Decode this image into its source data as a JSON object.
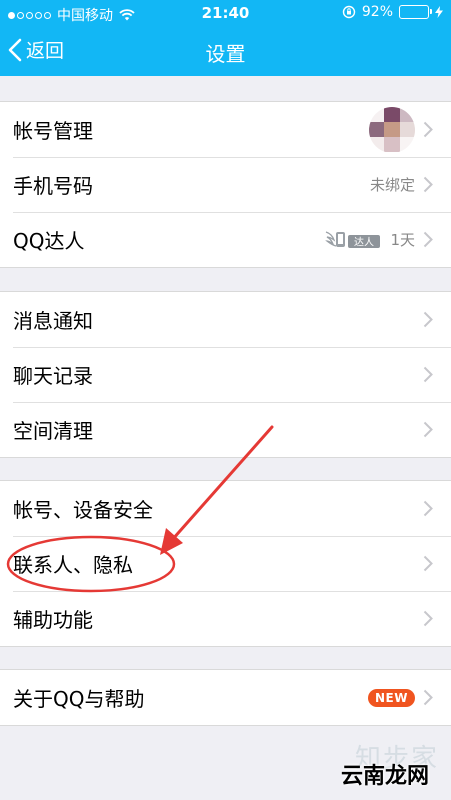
{
  "status_bar": {
    "carrier": "中国移动",
    "time": "21:40",
    "battery": "92%",
    "battery_level": 0.92
  },
  "nav": {
    "back_label": "返回",
    "title": "设置"
  },
  "groups": [
    {
      "rows": [
        {
          "label": "帐号管理",
          "value": "",
          "extra": "avatar"
        },
        {
          "label": "手机号码",
          "value": "未绑定"
        },
        {
          "label": "QQ达人",
          "value": "1天",
          "badge_text": "达人",
          "extra": "daren-badge"
        }
      ]
    },
    {
      "rows": [
        {
          "label": "消息通知"
        },
        {
          "label": "聊天记录"
        },
        {
          "label": "空间清理"
        }
      ]
    },
    {
      "rows": [
        {
          "label": "帐号、设备安全"
        },
        {
          "label": "联系人、隐私"
        },
        {
          "label": "辅助功能"
        }
      ]
    },
    {
      "rows": [
        {
          "label": "关于QQ与帮助",
          "badge_text": "NEW"
        }
      ]
    }
  ],
  "watermark": {
    "faint": "知步家",
    "text": "云南龙网"
  },
  "colors": {
    "accent": "#12b7f5",
    "annotation": "#e53935",
    "new_badge": "#f0541f",
    "background": "#efeff4"
  }
}
